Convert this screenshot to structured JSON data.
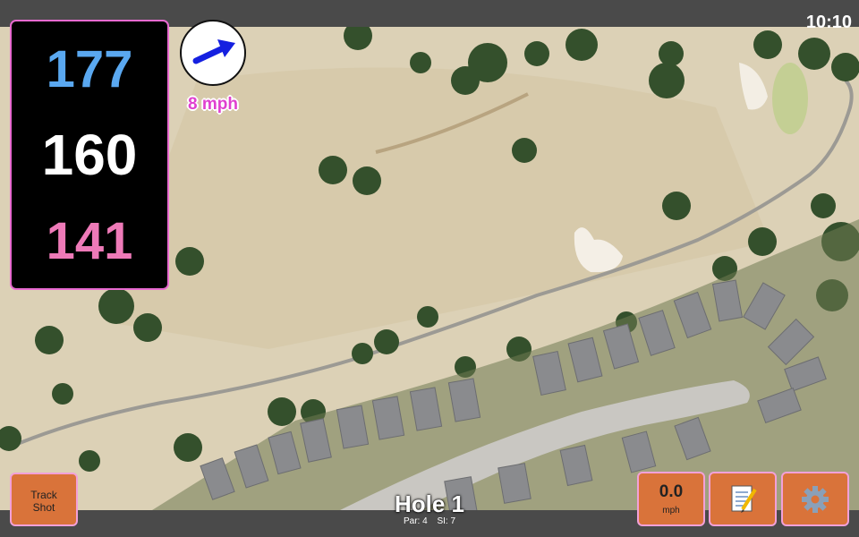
{
  "status_bar": {
    "time": "10:10"
  },
  "yardages": {
    "back": "177",
    "middle": "160",
    "front": "141"
  },
  "wind": {
    "speed_label": "8 mph",
    "icon": "arrow-right-icon"
  },
  "buttons": {
    "track_shot_line1": "Track",
    "track_shot_line2": "Shot",
    "shot_speed_value": "0.0",
    "shot_speed_unit": "mph",
    "notes_icon": "notepad-icon",
    "settings_icon": "gear-icon"
  },
  "hole": {
    "title": "Hole 1",
    "par": "Par: 4",
    "si": "SI: 7"
  },
  "colors": {
    "back_yardage": "#5aa8f0",
    "middle_yardage": "#ffffff",
    "front_yardage": "#ee7ab8",
    "button": "#d9733a",
    "accent_border": "#f2a0d8",
    "wind_text": "#e040d0"
  }
}
